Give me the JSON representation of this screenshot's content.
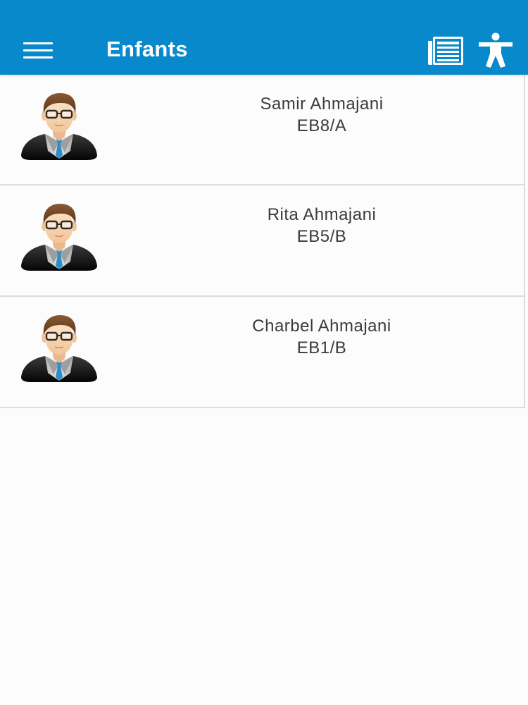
{
  "appbar": {
    "title": "Enfants",
    "menu_icon": "hamburger-menu-icon",
    "news_icon": "newspaper-icon",
    "accessibility_icon": "accessibility-person-icon",
    "background_color": "#0889cc"
  },
  "children": [
    {
      "name": "Samir Ahmajani",
      "class": "EB8/A"
    },
    {
      "name": "Rita Ahmajani",
      "class": "EB5/B"
    },
    {
      "name": "Charbel Ahmajani",
      "class": "EB1/B"
    }
  ]
}
